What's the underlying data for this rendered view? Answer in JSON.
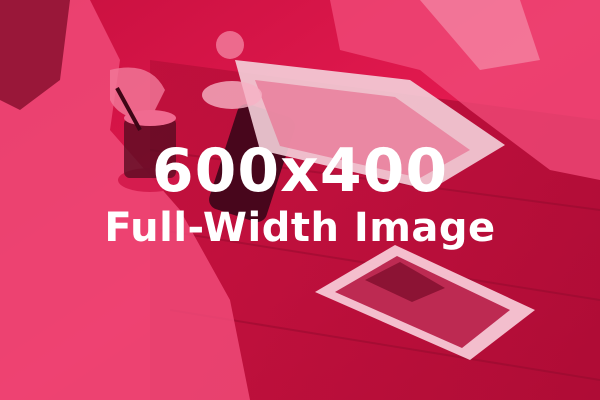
{
  "image": {
    "title": "600x400",
    "subtitle": "Full-Width Image",
    "tint_color": "#e31a52",
    "text_color": "#ffffff"
  }
}
